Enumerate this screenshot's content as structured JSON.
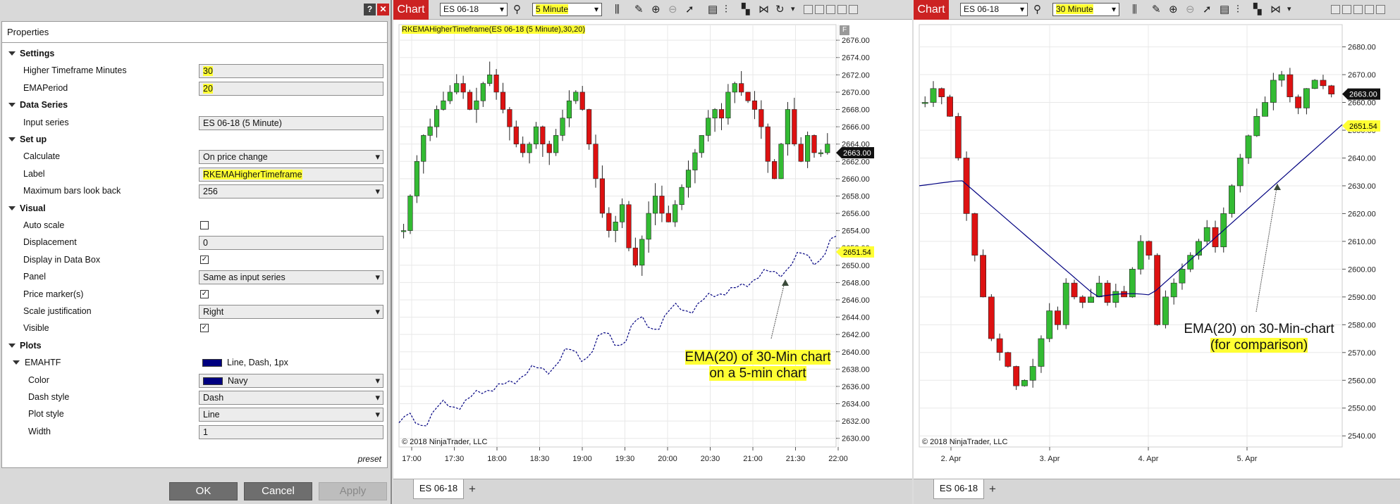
{
  "properties": {
    "title": "Properties",
    "help": "?",
    "close": "✕",
    "preset": "preset",
    "buttons": {
      "ok": "OK",
      "cancel": "Cancel",
      "apply": "Apply"
    },
    "sections": [
      {
        "type": "cat",
        "label": "Settings"
      },
      {
        "type": "val",
        "label": "Higher Timeframe Minutes",
        "value": "30",
        "hl": true
      },
      {
        "type": "val",
        "label": "EMAPeriod",
        "value": "20",
        "hl": true
      },
      {
        "type": "cat",
        "label": "Data Series"
      },
      {
        "type": "val",
        "label": "Input series",
        "value": "ES 06-18 (5 Minute)"
      },
      {
        "type": "cat",
        "label": "Set up"
      },
      {
        "type": "dd",
        "label": "Calculate",
        "value": "On price change"
      },
      {
        "type": "val",
        "label": "Label",
        "value": "RKEMAHigherTimeframe",
        "hl": true
      },
      {
        "type": "dd",
        "label": "Maximum bars look back",
        "value": "256"
      },
      {
        "type": "cat",
        "label": "Visual"
      },
      {
        "type": "chk",
        "label": "Auto scale",
        "checked": false
      },
      {
        "type": "val",
        "label": "Displacement",
        "value": "0"
      },
      {
        "type": "chk",
        "label": "Display in Data Box",
        "checked": true
      },
      {
        "type": "dd",
        "label": "Panel",
        "value": "Same as input series"
      },
      {
        "type": "chk",
        "label": "Price marker(s)",
        "checked": true
      },
      {
        "type": "dd",
        "label": "Scale justification",
        "value": "Right"
      },
      {
        "type": "chk",
        "label": "Visible",
        "checked": true
      },
      {
        "type": "cat",
        "label": "Plots"
      },
      {
        "type": "sub",
        "label": "EMAHTF",
        "value": "Line, Dash, 1px",
        "swatch": "#000080"
      },
      {
        "type": "dd",
        "label": "Color",
        "value": "Navy",
        "swatch": "#000080",
        "indent": true
      },
      {
        "type": "dd",
        "label": "Dash style",
        "value": "Dash",
        "indent": true
      },
      {
        "type": "dd",
        "label": "Plot style",
        "value": "Line",
        "indent": true
      },
      {
        "type": "val",
        "label": "Width",
        "value": "1",
        "indent": true
      }
    ]
  },
  "chart1": {
    "tab": "Chart",
    "instrument": "ES 06-18",
    "interval": "5 Minute",
    "indicator_label": "RKEMAHigherTimeframe(ES 06-18 (5 Minute),30,20)",
    "copyright": "© 2018 NinjaTrader, LLC",
    "bottom_tab": "ES 06-18",
    "annotation": [
      "EMA(20) of 30-Min chart",
      "on a 5-min chart"
    ],
    "price_markers": [
      "2663.00",
      "2651.54"
    ],
    "y_ticks": [
      "2676.00",
      "2674.00",
      "2672.00",
      "2670.00",
      "2668.00",
      "2666.00",
      "2664.00",
      "2662.00",
      "2660.00",
      "2658.00",
      "2656.00",
      "2654.00",
      "2652.00",
      "2650.00",
      "2648.00",
      "2646.00",
      "2644.00",
      "2642.00",
      "2640.00",
      "2638.00",
      "2636.00",
      "2634.00",
      "2632.00",
      "2630.00"
    ],
    "x_ticks": [
      "17:00",
      "17:30",
      "18:00",
      "18:30",
      "19:00",
      "19:30",
      "20:00",
      "20:30",
      "21:00",
      "21:30",
      "22:00"
    ]
  },
  "chart2": {
    "tab": "Chart",
    "instrument": "ES 06-18",
    "interval": "30 Minute",
    "copyright": "© 2018 NinjaTrader, LLC",
    "bottom_tab": "ES 06-18",
    "annotation": [
      "EMA(20) on 30-Min-chart",
      "(for comparison)"
    ],
    "price_markers": [
      "2663.00",
      "2651.54"
    ],
    "y_ticks": [
      "2680.00",
      "2670.00",
      "2660.00",
      "2650.00",
      "2640.00",
      "2630.00",
      "2620.00",
      "2610.00",
      "2600.00",
      "2590.00",
      "2580.00",
      "2570.00",
      "2560.00",
      "2550.00",
      "2540.00"
    ],
    "x_ticks": [
      "2. Apr",
      "3. Apr",
      "4. Apr",
      "5. Apr"
    ]
  },
  "colors": {
    "up": "#33bb33",
    "down": "#dd1111",
    "ema": "#000080",
    "tab": "#cc2222",
    "highlight": "#ffff33"
  }
}
